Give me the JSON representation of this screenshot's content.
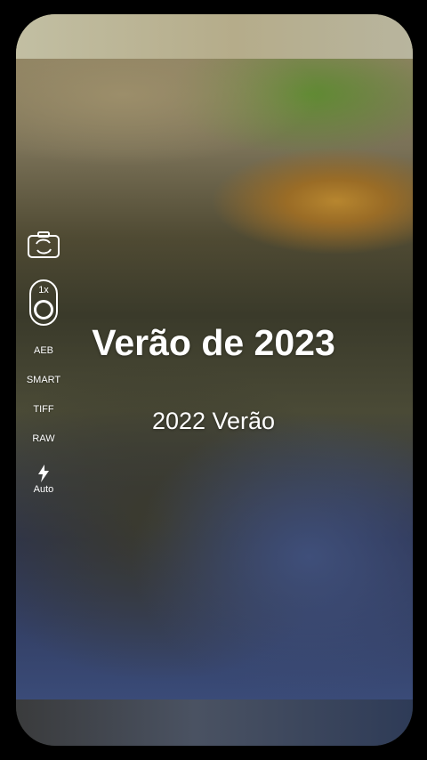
{
  "overlay": {
    "title": "Verão de 2023",
    "subtitle": "2022 Verão"
  },
  "camera_controls": {
    "switch_camera_icon": "camera-switch-icon",
    "zoom": "1x",
    "modes": [
      "AEB",
      "SMART",
      "TIFF",
      "RAW"
    ],
    "flash_icon": "flash-icon",
    "flash_mode": "Auto"
  },
  "colors": {
    "frame": "#000000",
    "text": "#ffffff"
  }
}
